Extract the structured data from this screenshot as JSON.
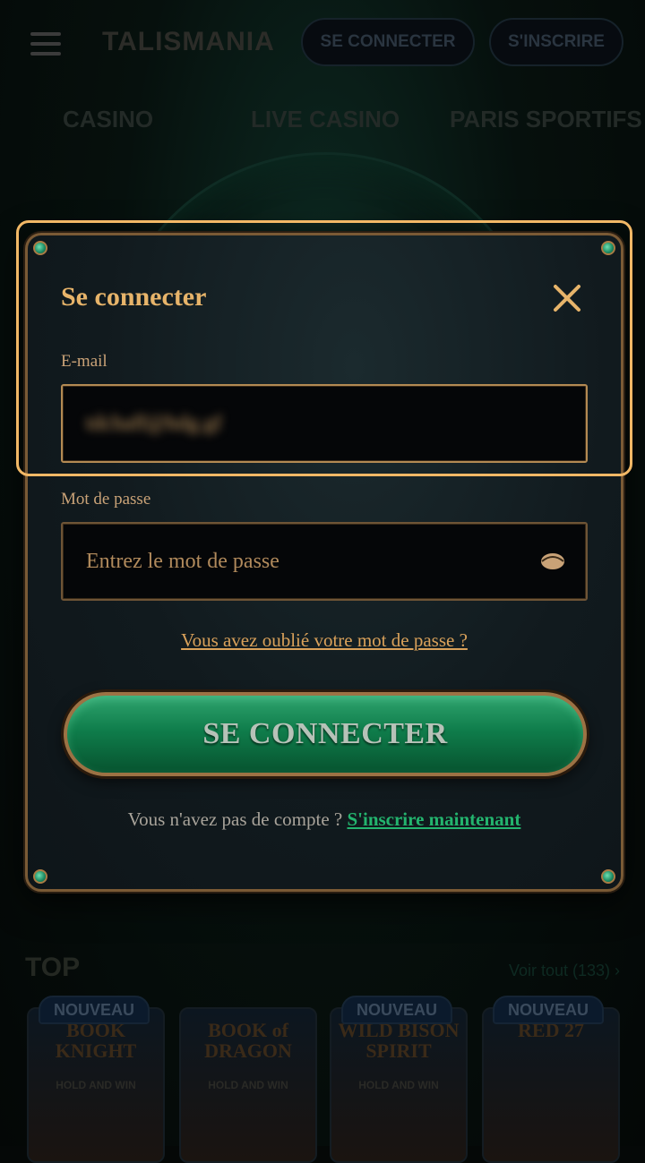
{
  "header": {
    "logo": "TALISMANIA",
    "login_label": "SE CONNECTER",
    "register_label": "S'INSCRIRE"
  },
  "nav": {
    "tabs": [
      "CASINO",
      "LIVE CASINO",
      "PARIS SPORTIFS"
    ]
  },
  "background": {
    "top_title": "TOP",
    "see_all": "Voir tout (133)",
    "badge_label": "NOUVEAU",
    "games": [
      {
        "name": "BOOK KNIGHT",
        "sub": "HOLD AND WIN"
      },
      {
        "name": "BOOK of DRAGON",
        "sub": "HOLD AND WIN"
      },
      {
        "name": "WILD BISON SPIRIT",
        "sub": "HOLD AND WIN"
      },
      {
        "name": "RED 27",
        "sub": ""
      }
    ]
  },
  "modal": {
    "title": "Se connecter",
    "email_label": "E-mail",
    "email_value": "tdchaff@hdg.gf",
    "password_label": "Mot de passe",
    "password_placeholder": "Entrez le mot de passe",
    "forgot_link": "Vous avez oublié votre mot de passe ?",
    "submit_label": "SE CONNECTER",
    "no_account_text": "Vous n'avez pas de compte ?",
    "signup_link": "S'inscrire maintenant"
  },
  "colors": {
    "accent_gold": "#e7b46a",
    "button_green": "#0f7d4b",
    "link_green": "#23b46e",
    "highlight": "#f2b866"
  }
}
